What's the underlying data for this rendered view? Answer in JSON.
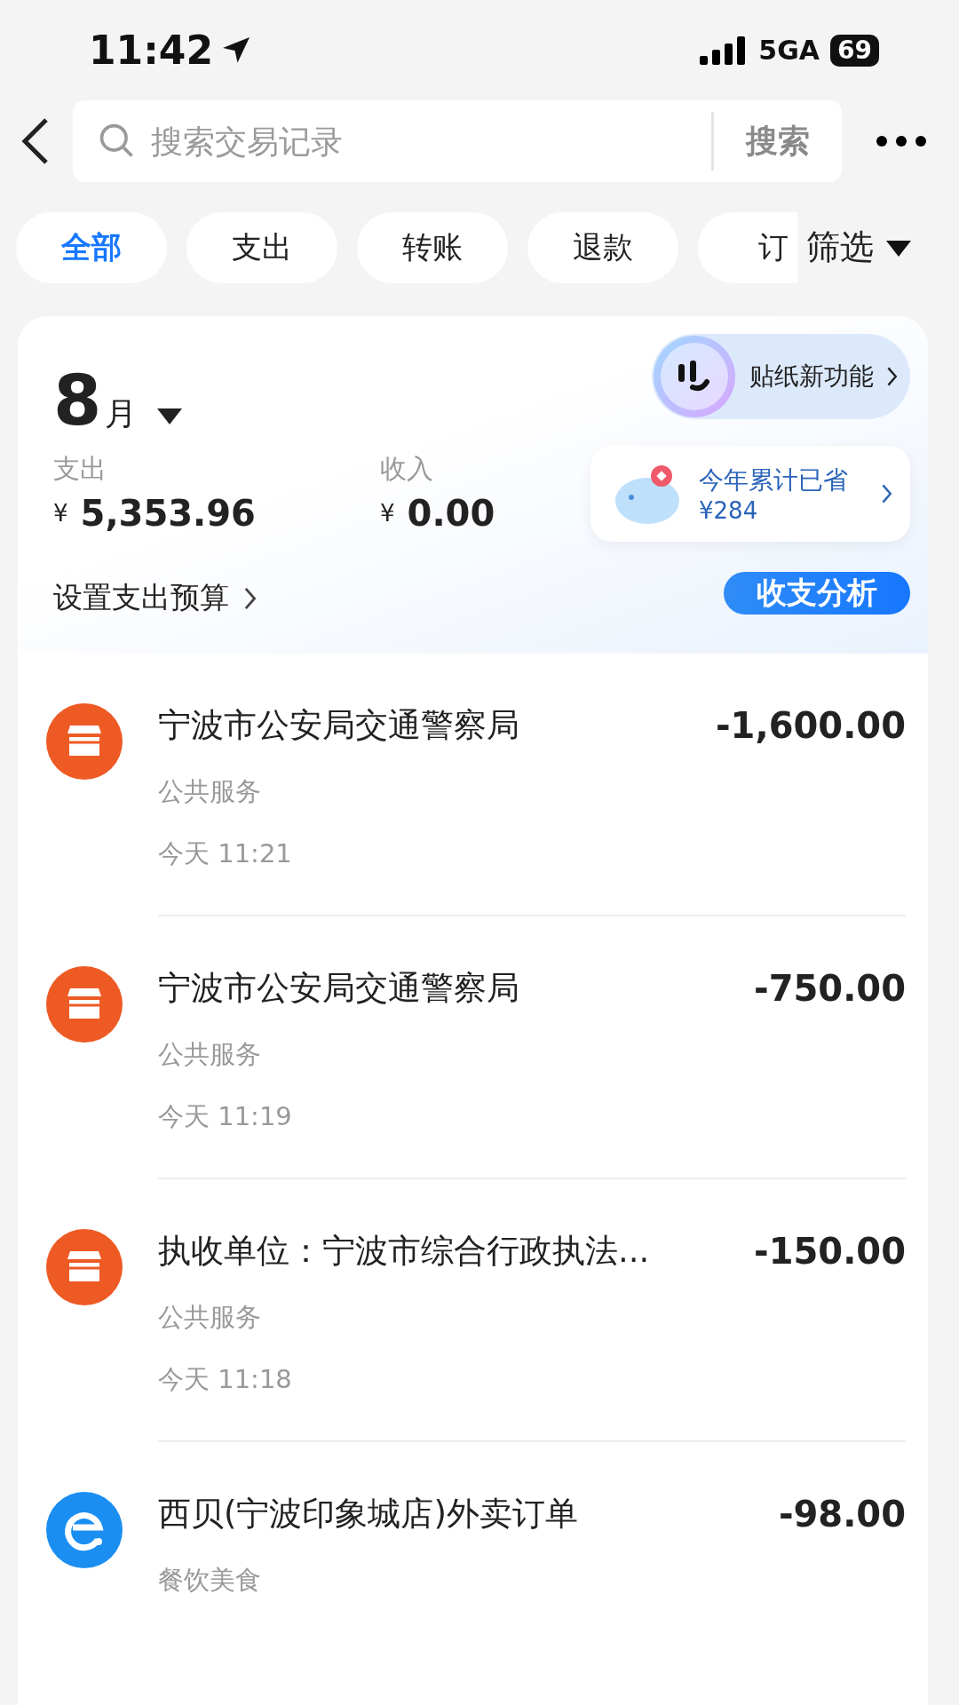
{
  "status_bar": {
    "time": "11:42",
    "network": "5GA",
    "battery": "69"
  },
  "search": {
    "placeholder": "搜索交易记录",
    "button": "搜索"
  },
  "tabs": [
    {
      "label": "全部",
      "selected": true
    },
    {
      "label": "支出",
      "selected": false
    },
    {
      "label": "转账",
      "selected": false
    },
    {
      "label": "退款",
      "selected": false
    },
    {
      "label": "订",
      "selected": false
    }
  ],
  "filter": {
    "label": "筛选"
  },
  "summary": {
    "month_number": "8",
    "month_unit": "月",
    "expense_label": "支出",
    "expense_currency": "¥",
    "expense_value": "5,353.96",
    "income_label": "收入",
    "income_currency": "¥",
    "income_value": "0.00",
    "budget_link": "设置支出预算",
    "sticker_banner": "贴纸新功能",
    "savings_label": "今年累计已省",
    "savings_value": "¥284",
    "analysis_button": "收支分析"
  },
  "transactions": [
    {
      "kind": "shop",
      "title": "宁波市公安局交通警察局",
      "category": "公共服务",
      "time": "今天 11:21",
      "amount": "-1,600.00"
    },
    {
      "kind": "shop",
      "title": "宁波市公安局交通警察局",
      "category": "公共服务",
      "time": "今天 11:19",
      "amount": "-750.00"
    },
    {
      "kind": "shop",
      "title": "执收单位：宁波市综合行政执法...",
      "category": "公共服务",
      "time": "今天 11:18",
      "amount": "-150.00"
    },
    {
      "kind": "delivery",
      "title": "西贝(宁波印象城店)外卖订单",
      "category": "餐饮美食",
      "amount": "-98.00"
    }
  ]
}
